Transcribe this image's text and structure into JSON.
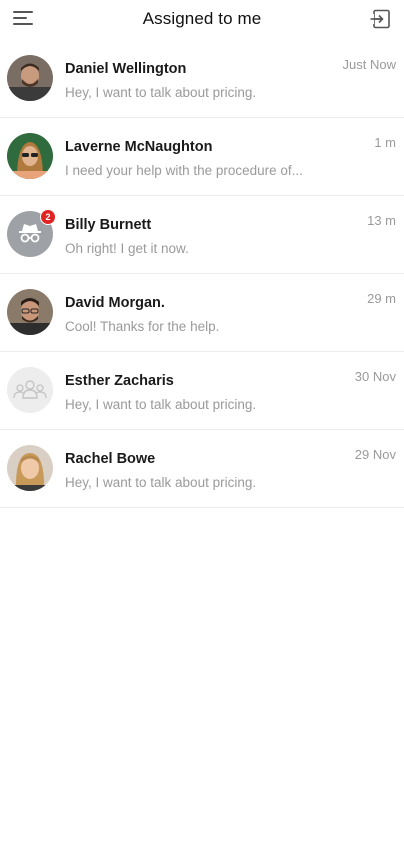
{
  "header": {
    "title": "Assigned to me",
    "menu_icon": "hamburger-menu-icon",
    "exit_icon": "sign-out-icon"
  },
  "conversations": [
    {
      "name": "Daniel Wellington",
      "preview": "Hey, I want to talk about pricing.",
      "time": "Just Now",
      "avatar": "photo"
    },
    {
      "name": "Laverne McNaughton",
      "preview": "I need your help with the procedure of...",
      "time": "1 m",
      "avatar": "photo"
    },
    {
      "name": "Billy Burnett",
      "preview": "Oh right! I get it now.",
      "time": "13 m",
      "avatar": "incognito-icon",
      "badge": "2"
    },
    {
      "name": "David Morgan.",
      "preview": "Cool! Thanks for the help.",
      "time": "29 m",
      "avatar": "photo"
    },
    {
      "name": "Esther Zacharis",
      "preview": "Hey, I want to talk about pricing.",
      "time": "30 Nov",
      "avatar": "group-icon"
    },
    {
      "name": "Rachel Bowe",
      "preview": "Hey, I want to talk about pricing.",
      "time": "29 Nov",
      "avatar": "photo"
    }
  ],
  "colors": {
    "badge": "#e02424",
    "muted_text": "#9a9a9a",
    "divider": "#ececec"
  }
}
